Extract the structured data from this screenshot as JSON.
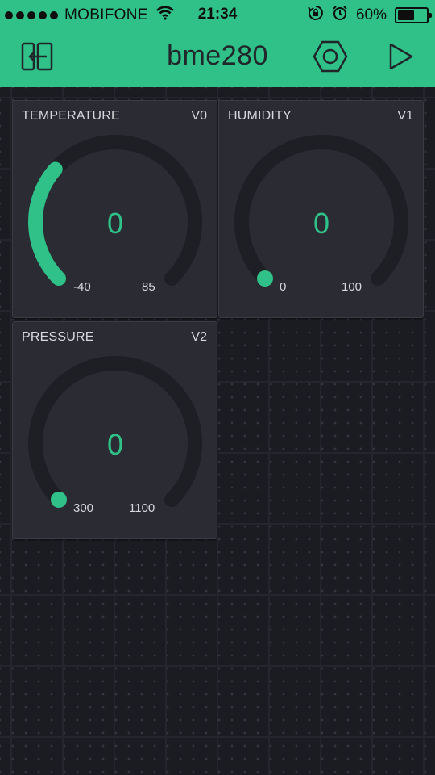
{
  "status_bar": {
    "carrier": "MOBIFONE",
    "time": "21:34",
    "battery_percent": "60%",
    "battery_level": 0.6
  },
  "app_bar": {
    "title": "bme280",
    "icons": {
      "left": "exit-icon",
      "settings": "hexagon-settings-icon",
      "play": "play-icon"
    }
  },
  "widgets": [
    {
      "label": "TEMPERATURE",
      "pin": "V0",
      "value": "0",
      "min": "-40",
      "max": "85",
      "fill_fraction": 0.32
    },
    {
      "label": "HUMIDITY",
      "pin": "V1",
      "value": "0",
      "min": "0",
      "max": "100",
      "fill_fraction": 0
    },
    {
      "label": "PRESSURE",
      "pin": "V2",
      "value": "0",
      "min": "300",
      "max": "1100",
      "fill_fraction": 0
    }
  ],
  "colors": {
    "accent": "#2fc188",
    "background": "#1b1c22",
    "widget_bg": "#2a2b33",
    "gauge_track": "#1e1f24",
    "text": "#d7d8dc"
  }
}
